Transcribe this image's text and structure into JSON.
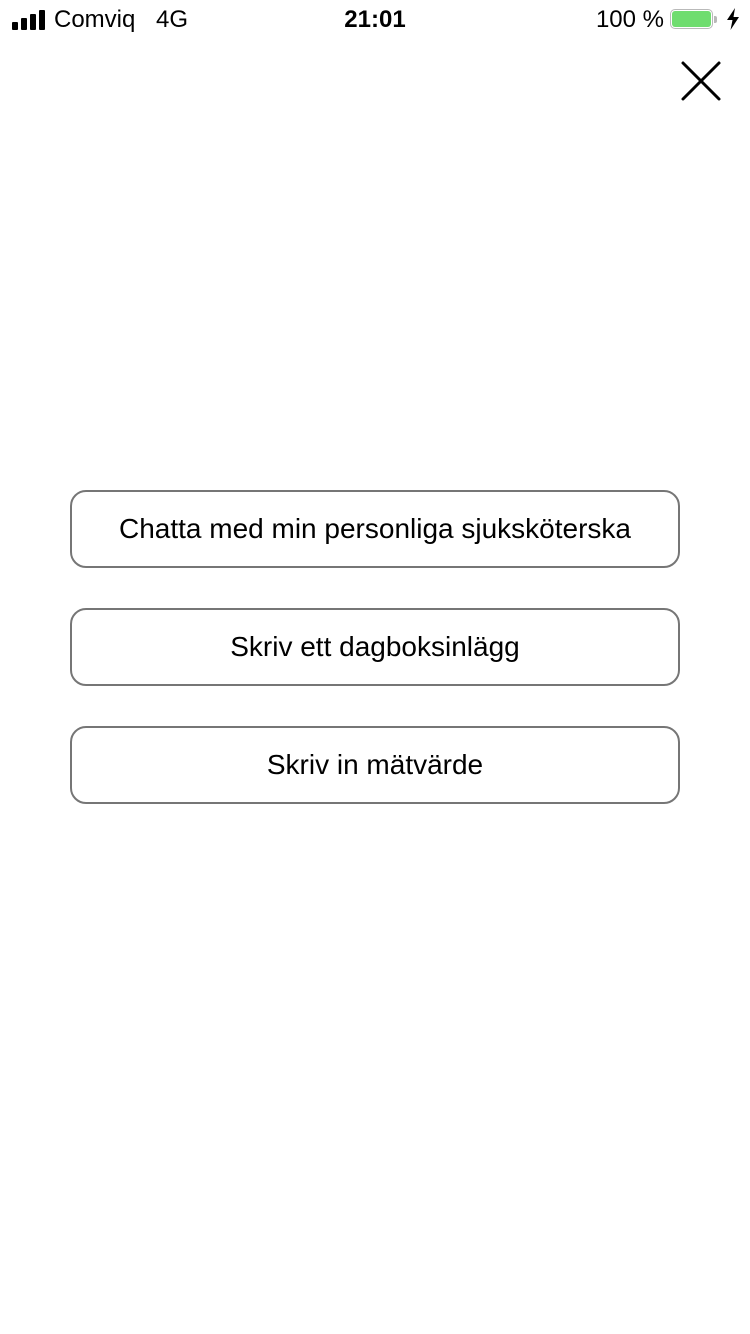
{
  "status_bar": {
    "signal_bars": 4,
    "carrier": "Comviq",
    "network": "4G",
    "time": "21:01",
    "battery_percent_label": "100 %",
    "battery_level": 1.0,
    "battery_color": "#6fdd6f",
    "charging_icon": "bolt-icon"
  },
  "header": {
    "close_icon": "close-icon"
  },
  "actions": [
    {
      "label": "Chatta med min personliga sjuksköterska"
    },
    {
      "label": "Skriv ett dagboksinlägg"
    },
    {
      "label": "Skriv in mätvärde"
    }
  ]
}
